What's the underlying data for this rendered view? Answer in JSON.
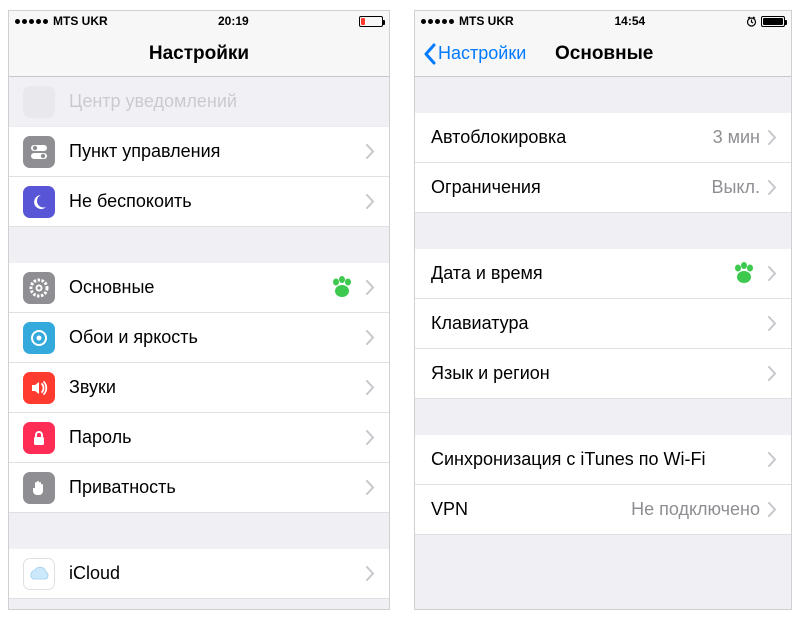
{
  "left": {
    "carrier": "MTS UKR",
    "time": "20:19",
    "title": "Настройки",
    "faded_label": "Центр уведомлений",
    "group1": [
      {
        "label": "Пункт управления"
      },
      {
        "label": "Не беспокоить"
      }
    ],
    "group2": [
      {
        "label": "Основные",
        "paw": true
      },
      {
        "label": "Обои и яркость"
      },
      {
        "label": "Звуки"
      },
      {
        "label": "Пароль"
      },
      {
        "label": "Приватность"
      }
    ],
    "group3": [
      {
        "label": "iCloud"
      }
    ]
  },
  "right": {
    "carrier": "MTS UKR",
    "time": "14:54",
    "back": "Настройки",
    "title": "Основные",
    "group1": [
      {
        "label": "Автоблокировка",
        "detail": "3 мин"
      },
      {
        "label": "Ограничения",
        "detail": "Выкл."
      }
    ],
    "group2": [
      {
        "label": "Дата и время",
        "paw": true
      },
      {
        "label": "Клавиатура"
      },
      {
        "label": "Язык и регион"
      }
    ],
    "group3": [
      {
        "label": "Синхронизация с iTunes по Wi-Fi"
      },
      {
        "label": "VPN",
        "detail": "Не подключено"
      }
    ]
  }
}
